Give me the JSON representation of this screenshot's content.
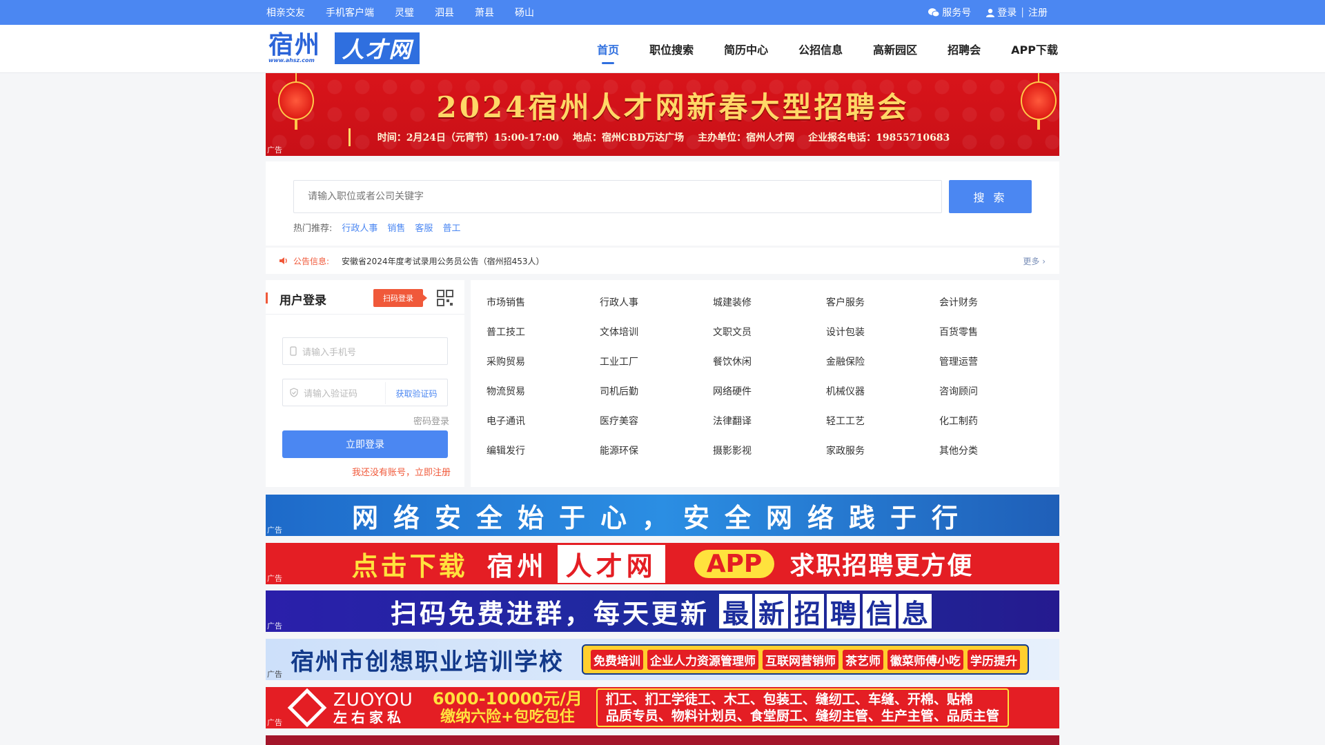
{
  "topbar": {
    "links": [
      "相亲交友",
      "手机客户端",
      "灵璧",
      "泗县",
      "萧县",
      "砀山"
    ],
    "service_label": "服务号",
    "login_label": "登录",
    "register_label": "注册"
  },
  "header": {
    "logo_left": "宿州",
    "logo_url": "www.ahsz.com",
    "logo_right": "人才网",
    "nav": [
      "首页",
      "职位搜索",
      "简历中心",
      "公招信息",
      "高新园区",
      "招聘会",
      "APP下载"
    ],
    "active_nav": "首页"
  },
  "banner": {
    "title": "2024宿州人才网新春大型招聘会",
    "time": "时间：2月24日（元宵节）15:00-17:00",
    "place": "地点：宿州CBD万达广场",
    "organizer": "主办单位：宿州人才网",
    "phone": "企业报名电话：19855710683",
    "ad_tag": "广告"
  },
  "search": {
    "placeholder": "请输入职位或者公司关键字",
    "button_label": "搜 索",
    "hot_label": "热门推荐:",
    "hot_keywords": [
      "行政人事",
      "销售",
      "客服",
      "普工"
    ]
  },
  "notice": {
    "label": "公告信息:",
    "text": "安徽省2024年度考试录用公务员公告（宿州招453人）",
    "more": "更多 ›"
  },
  "login": {
    "title": "用户登录",
    "scan_label": "扫码登录",
    "phone_placeholder": "请输入手机号",
    "code_placeholder": "请输入验证码",
    "get_code": "获取验证码",
    "password_login": "密码登录",
    "submit": "立即登录",
    "register_link": "我还没有账号，立即注册"
  },
  "categories": [
    "市场销售",
    "行政人事",
    "城建装修",
    "客户服务",
    "会计财务",
    "普工技工",
    "文体培训",
    "文职文员",
    "设计包装",
    "百货零售",
    "采购贸易",
    "工业工厂",
    "餐饮休闲",
    "金融保险",
    "管理运营",
    "物流贸易",
    "司机后勤",
    "网络硬件",
    "机械仪器",
    "咨询顾问",
    "电子通讯",
    "医疗美容",
    "法律翻译",
    "轻工工艺",
    "化工制药",
    "编辑发行",
    "能源环保",
    "摄影影视",
    "家政服务",
    "其他分类"
  ],
  "ads": {
    "tag": "广告",
    "ad1": "网络安全始于心，安全网络践于行",
    "ad2": {
      "a": "点击下载",
      "b": "宿州",
      "c": "人才网",
      "d": "APP",
      "e": "求职招聘更方便"
    },
    "ad3": {
      "a": "扫码免费进群，每天更新",
      "cells": [
        "最",
        "新",
        "招",
        "聘",
        "信",
        "息"
      ]
    },
    "ad4": {
      "school": "宿州市创想职业培训学校",
      "tags": [
        "免费培训",
        "企业人力资源管理师",
        "互联网营销师",
        "茶艺师",
        "徽菜师傅小吃",
        "学历提升"
      ]
    },
    "ad5": {
      "en": "ZUOYOU",
      "cn": "左右家私",
      "salary": "6000-10000元/月",
      "benefit": "缴纳六险+包吃包住",
      "jobs1": "扪工、扪工学徒工、木工、包装工、缝纫工、车缝、开棉、贴棉",
      "jobs2": "品质专员、物料计划员、食堂厨工、缝纫主管、生产主管、品质主管"
    }
  },
  "colors": {
    "primary": "#4b87f2",
    "accent": "#f0593a",
    "banner_red": "#d9141a"
  }
}
